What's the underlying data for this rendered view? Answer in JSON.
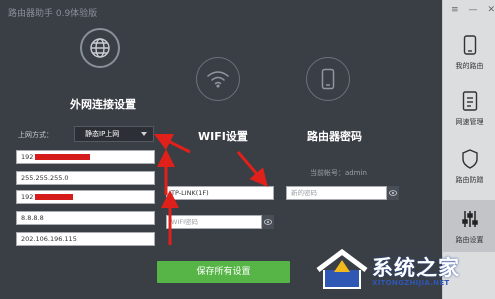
{
  "app": {
    "title": "路由器助手 0.9体验版"
  },
  "window_controls": {
    "menu": "≡",
    "minimize": "—",
    "close": "✕"
  },
  "wan": {
    "title": "外网连接设置",
    "conn_type_label": "上网方式：",
    "conn_type_value": "静态IP上网",
    "fields": [
      {
        "name": "ip-address-field",
        "value": "192",
        "redacted": true
      },
      {
        "name": "subnet-mask-field",
        "value": "255.255.255.0",
        "redacted": false
      },
      {
        "name": "gateway-field",
        "value": "192",
        "redacted": true
      },
      {
        "name": "dns-primary-field",
        "value": "8.8.8.8",
        "redacted": false
      },
      {
        "name": "dns-secondary-field",
        "value": "202.106.196.115",
        "redacted": false
      }
    ]
  },
  "wifi": {
    "title": "WIFI设置",
    "ssid_value": "TP-LINK(1F)",
    "password_placeholder": "WIFI密码"
  },
  "router_pwd": {
    "title": "路由器密码",
    "account_label": "当前帐号：admin",
    "new_password_placeholder": "新的密码"
  },
  "save_button": "保存所有设置",
  "sidebar": {
    "items": [
      {
        "label": "我的路由",
        "icon": "phone-router-icon",
        "active": false
      },
      {
        "label": "网速管理",
        "icon": "speed-meter-icon",
        "active": false
      },
      {
        "label": "路由防蹭",
        "icon": "shield-icon",
        "active": false
      },
      {
        "label": "路由设置",
        "icon": "sliders-icon",
        "active": true
      }
    ]
  },
  "watermark": {
    "text": "系统之家",
    "sub": "XITONGZHIJIA.NET"
  },
  "colors": {
    "bg": "#3a3e45",
    "sidebar": "#dcdddf",
    "accent_green": "#57b548",
    "arrow_red": "#e0201a"
  }
}
